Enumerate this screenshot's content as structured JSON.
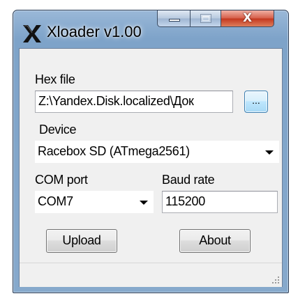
{
  "window": {
    "title": "Xloader v1.00",
    "icons": {
      "app": "xloader-x-icon",
      "minimize": "minimize-icon",
      "maximize": "maximize-icon",
      "close": "close-icon"
    },
    "close_glyph": "X"
  },
  "hex_file": {
    "label": "Hex file",
    "value": "Z:\\Yandex.Disk.localized\\Док",
    "browse_label": "..."
  },
  "device": {
    "label": "Device",
    "selected": "Racebox SD (ATmega2561)"
  },
  "com_port": {
    "label": "COM port",
    "selected": "COM7"
  },
  "baud_rate": {
    "label": "Baud rate",
    "value": "115200"
  },
  "buttons": {
    "upload": "Upload",
    "about": "About"
  },
  "colors": {
    "title_bar": "#86a9cc",
    "close_button": "#c4381f",
    "client_background": "#f0f0f0",
    "browse_button": "#bee6fd"
  }
}
